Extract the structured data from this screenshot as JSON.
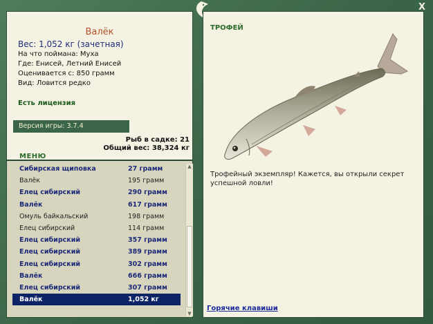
{
  "fish": {
    "name": "Валёк",
    "weight_line": "Вес: 1,052 кг (зачетная)",
    "caught_on": "На что поймана: Муха",
    "location": "Где: Енисей, Летний Енисей",
    "valued_from": "Оценивается с: 850 грамм",
    "rarity": "Вид: Ловится редко"
  },
  "license": "Есть лицензия",
  "version": "Версия игры: 3.7.4",
  "stats": {
    "fish_count": "Рыб в садке: 21",
    "total_weight": "Общий вес: 38,324 кг"
  },
  "menu_label": "МЕНЮ",
  "catch_list": [
    {
      "name": "Сибирская щиповка",
      "weight": "27 грамм",
      "style": "trophy"
    },
    {
      "name": "Валёк",
      "weight": "195 грамм",
      "style": "plain"
    },
    {
      "name": "Елец сибирский",
      "weight": "290 грамм",
      "style": "trophy"
    },
    {
      "name": "Валёк",
      "weight": "617 грамм",
      "style": "trophy"
    },
    {
      "name": "Омуль байкальский",
      "weight": "198 грамм",
      "style": "plain"
    },
    {
      "name": "Елец сибирский",
      "weight": "114 грамм",
      "style": "plain"
    },
    {
      "name": "Елец сибирский",
      "weight": "357 грамм",
      "style": "trophy"
    },
    {
      "name": "Елец сибирский",
      "weight": "389 грамм",
      "style": "trophy"
    },
    {
      "name": "Елец сибирский",
      "weight": "302 грамм",
      "style": "trophy"
    },
    {
      "name": "Валёк",
      "weight": "666 грамм",
      "style": "trophy"
    },
    {
      "name": "Елец сибирский",
      "weight": "307 грамм",
      "style": "trophy"
    },
    {
      "name": "Валёк",
      "weight": "1,052 кг",
      "style": "sel"
    }
  ],
  "trophy_label": "ТРОФЕЙ",
  "trophy_text": "Трофейный экземпляр! Кажется, вы открыли секрет успешной ловли!",
  "hotkeys": "Горячие клавиши",
  "close_glyph": "X",
  "colors": {
    "frame": "#3f6a4c",
    "panel": "#f4f3e3",
    "selection": "#0c2365",
    "trophy_text": "#1d2a7a"
  }
}
